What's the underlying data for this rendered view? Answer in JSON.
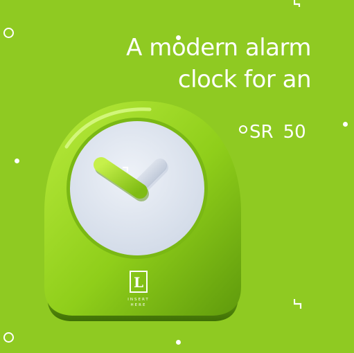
{
  "ad": {
    "headline_line1": "A modern alarm",
    "headline_line2": "clock for an",
    "price_currency": "SR",
    "price_value": "50",
    "logo_letter": "L",
    "logo_tagline_1": "INSERT",
    "logo_tagline_2": "HERE"
  },
  "colors": {
    "background": "#8fca22",
    "clock_body": "#9ad62a",
    "clock_face": "#dfe6f1",
    "hour_hand": "#a6dc2e",
    "minute_hand": "#c8d2e2",
    "text": "#ffffff"
  },
  "clock": {
    "shown_time": "10:05"
  }
}
